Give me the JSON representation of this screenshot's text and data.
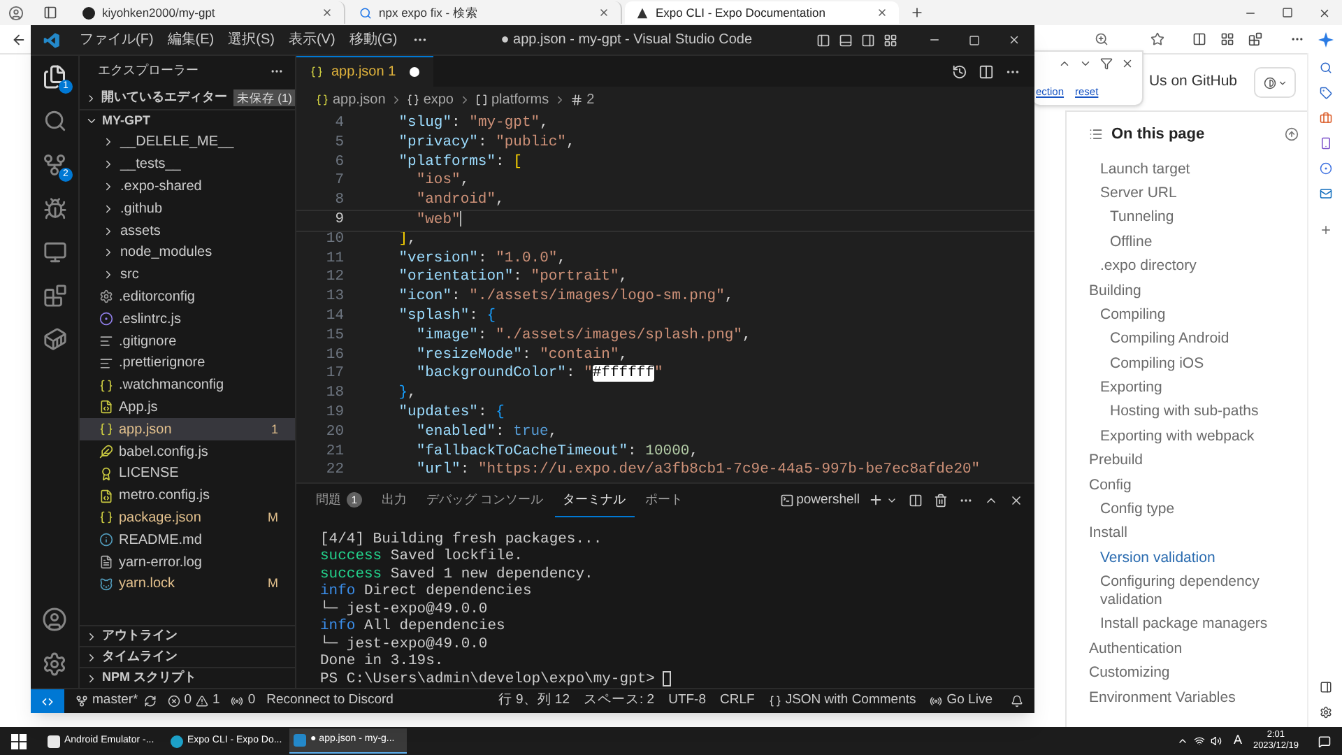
{
  "browser": {
    "tabs": [
      {
        "title": "kiyohken2000/my-gpt",
        "selected": false,
        "kind": "github"
      },
      {
        "title": "npx expo fix - 検索",
        "selected": false,
        "kind": "search"
      },
      {
        "title": "Expo CLI - Expo Documentation",
        "selected": true,
        "kind": "expo"
      }
    ],
    "find_bar": {
      "links": [
        "ection",
        "reset"
      ]
    },
    "header_link": "Us on GitHub"
  },
  "toc": {
    "title": "On this page",
    "items": [
      {
        "children": [
          {
            "label": "Launch target",
            "selected": false
          },
          {
            "label": "Server URL",
            "selected": false,
            "children": [
              {
                "label": "Tunneling",
                "selected": false
              },
              {
                "label": "Offline",
                "selected": false
              }
            ]
          },
          {
            "label": ".expo directory",
            "selected": false
          }
        ]
      },
      {
        "label": "Building",
        "selected": false,
        "children": [
          {
            "label": "Compiling",
            "selected": false,
            "children": [
              {
                "label": "Compiling Android",
                "selected": false
              },
              {
                "label": "Compiling iOS",
                "selected": false
              }
            ]
          },
          {
            "label": "Exporting",
            "selected": false,
            "children": [
              {
                "label": "Hosting with sub-paths",
                "selected": false
              }
            ]
          },
          {
            "label": "Exporting with webpack",
            "selected": false
          }
        ]
      },
      {
        "label": "Prebuild",
        "selected": false
      },
      {
        "label": "Config",
        "selected": false,
        "children": [
          {
            "label": "Config type",
            "selected": false
          }
        ]
      },
      {
        "label": "Install",
        "selected": false,
        "children": [
          {
            "label": "Version validation",
            "selected": true
          },
          {
            "label": "Configuring dependency validation",
            "selected": false
          },
          {
            "label": "Install package managers",
            "selected": false
          }
        ]
      },
      {
        "label": "Authentication",
        "selected": false
      },
      {
        "label": "Customizing",
        "selected": false
      },
      {
        "label": "Environment Variables",
        "selected": false
      }
    ]
  },
  "vscode": {
    "title": "● app.json - my-gpt - Visual Studio Code",
    "menus": [
      "ファイル(F)",
      "編集(E)",
      "選択(S)",
      "表示(V)",
      "移動(G)"
    ],
    "explorer_badge": "1",
    "scm_badge": "2",
    "sidebar": {
      "title": "エクスプローラー",
      "open_editors": {
        "label": "開いているエディター",
        "badge": "未保存 (1)"
      },
      "folder": {
        "label": "MY-GPT",
        "expanded": true,
        "items": [
          {
            "name": "__DELELE_ME__",
            "kind": "folder",
            "flagged": false,
            "selected": false
          },
          {
            "name": "__tests__",
            "kind": "folder",
            "flagged": false,
            "selected": false
          },
          {
            "name": ".expo-shared",
            "kind": "folder",
            "flagged": false,
            "selected": false
          },
          {
            "name": ".github",
            "kind": "folder",
            "flagged": false,
            "selected": false
          },
          {
            "name": "assets",
            "kind": "folder",
            "flagged": false,
            "selected": false
          },
          {
            "name": "node_modules",
            "kind": "folder",
            "flagged": false,
            "selected": false
          },
          {
            "name": "src",
            "kind": "folder",
            "flagged": false,
            "selected": false
          },
          {
            "name": ".editorconfig",
            "kind": "gear",
            "flagged": false,
            "selected": false
          },
          {
            "name": ".eslintrc.js",
            "kind": "eslint",
            "flagged": false,
            "selected": false
          },
          {
            "name": ".gitignore",
            "kind": "lines",
            "flagged": false,
            "selected": false
          },
          {
            "name": ".prettierignore",
            "kind": "lines",
            "flagged": false,
            "selected": false
          },
          {
            "name": ".watchmanconfig",
            "kind": "braces",
            "flagged": false,
            "selected": false
          },
          {
            "name": "App.js",
            "kind": "js",
            "flagged": false,
            "selected": false
          },
          {
            "name": "app.json",
            "kind": "braces",
            "flagged": true,
            "badge": "1",
            "selected": true
          },
          {
            "name": "babel.config.js",
            "kind": "babel",
            "flagged": false,
            "selected": false
          },
          {
            "name": "LICENSE",
            "kind": "license",
            "flagged": false,
            "selected": false
          },
          {
            "name": "metro.config.js",
            "kind": "js",
            "flagged": false,
            "selected": false
          },
          {
            "name": "package.json",
            "kind": "braces",
            "flagged": true,
            "badge": "M",
            "selected": false
          },
          {
            "name": "README.md",
            "kind": "info",
            "flagged": false,
            "selected": false
          },
          {
            "name": "yarn-error.log",
            "kind": "log",
            "flagged": false,
            "selected": false
          },
          {
            "name": "yarn.lock",
            "kind": "yarn",
            "flagged": true,
            "badge": "M",
            "selected": false
          }
        ]
      },
      "sections": [
        "アウトライン",
        "タイムライン",
        "NPM スクリプト"
      ]
    },
    "editor": {
      "tab": {
        "label": "app.json",
        "problems": "1",
        "dirty": true
      },
      "breadcrumb": [
        {
          "label": "app.json",
          "kind": "file"
        },
        {
          "label": "expo",
          "kind": "object"
        },
        {
          "label": "platforms",
          "kind": "array"
        },
        {
          "label": "2",
          "kind": "index"
        }
      ],
      "lines": [
        {
          "n": "4",
          "current": false,
          "text": "    \"slug\": \"my-gpt\","
        },
        {
          "n": "5",
          "current": false,
          "text": "    \"privacy\": \"public\","
        },
        {
          "n": "6",
          "current": false,
          "text": "    \"platforms\": ["
        },
        {
          "n": "7",
          "current": false,
          "text": "      \"ios\","
        },
        {
          "n": "8",
          "current": false,
          "text": "      \"android\","
        },
        {
          "n": "9",
          "current": true,
          "text": "      \"web\""
        },
        {
          "n": "10",
          "current": false,
          "text": "    ],"
        },
        {
          "n": "11",
          "current": false,
          "text": "    \"version\": \"1.0.0\","
        },
        {
          "n": "12",
          "current": false,
          "text": "    \"orientation\": \"portrait\","
        },
        {
          "n": "13",
          "current": false,
          "text": "    \"icon\": \"./assets/images/logo-sm.png\","
        },
        {
          "n": "14",
          "current": false,
          "text": "    \"splash\": {"
        },
        {
          "n": "15",
          "current": false,
          "text": "      \"image\": \"./assets/images/splash.png\","
        },
        {
          "n": "16",
          "current": false,
          "text": "      \"resizeMode\": \"contain\","
        },
        {
          "n": "17",
          "current": false,
          "text": "      \"backgroundColor\": \"#ffffff\""
        },
        {
          "n": "18",
          "current": false,
          "text": "    },"
        },
        {
          "n": "19",
          "current": false,
          "text": "    \"updates\": {"
        },
        {
          "n": "20",
          "current": false,
          "text": "      \"enabled\": true,"
        },
        {
          "n": "21",
          "current": false,
          "text": "      \"fallbackToCacheTimeout\": 10000,"
        },
        {
          "n": "22",
          "current": false,
          "text": "      \"url\": \"https://u.expo.dev/a3fb8cb1-7c9e-44a5-997b-be7ec8afde20\""
        }
      ]
    },
    "panel": {
      "tabs": [
        {
          "label": "問題",
          "badge": "1",
          "selected": false
        },
        {
          "label": "出力",
          "selected": false
        },
        {
          "label": "デバッグ コンソール",
          "selected": false
        },
        {
          "label": "ターミナル",
          "selected": true
        },
        {
          "label": "ポート",
          "selected": false
        }
      ],
      "shell": "powershell",
      "terminal": [
        {
          "text": "[4/4] Building fresh packages..."
        },
        {
          "prefix": "success",
          "kind": "ok",
          "text": "Saved lockfile."
        },
        {
          "prefix": "success",
          "kind": "ok",
          "text": "Saved 1 new dependency."
        },
        {
          "prefix": "info",
          "kind": "info",
          "text": "Direct dependencies"
        },
        {
          "text": "└─ jest-expo@49.0.0"
        },
        {
          "prefix": "info",
          "kind": "info",
          "text": "All dependencies"
        },
        {
          "text": "└─ jest-expo@49.0.0"
        },
        {
          "text": "Done in 3.19s."
        },
        {
          "text": "PS C:\\Users\\admin\\develop\\expo\\my-gpt>"
        }
      ],
      "cursor_visible": true
    },
    "status_bar": {
      "branch": "master*",
      "errors": "0",
      "warnings": "1",
      "ports": "0",
      "message": "Reconnect to Discord",
      "right": [
        {
          "label": "行 9、列 12",
          "kind": "text"
        },
        {
          "label": "スペース: 2",
          "kind": "text"
        },
        {
          "label": "UTF-8",
          "kind": "text"
        },
        {
          "label": "CRLF",
          "kind": "text"
        },
        {
          "label": "JSON with Comments",
          "kind": "language"
        },
        {
          "label": "Go Live",
          "kind": "live"
        }
      ]
    }
  },
  "taskbar": {
    "apps": [
      {
        "label": "Android Emulator -...",
        "selected": false,
        "kind": "emulator"
      },
      {
        "label": "Expo CLI - Expo Do...",
        "selected": false,
        "kind": "browser"
      },
      {
        "label": "● app.json - my-g...",
        "selected": true,
        "kind": "editor"
      }
    ],
    "ime": "A",
    "time": "2:01",
    "date": "2023/12/19"
  }
}
